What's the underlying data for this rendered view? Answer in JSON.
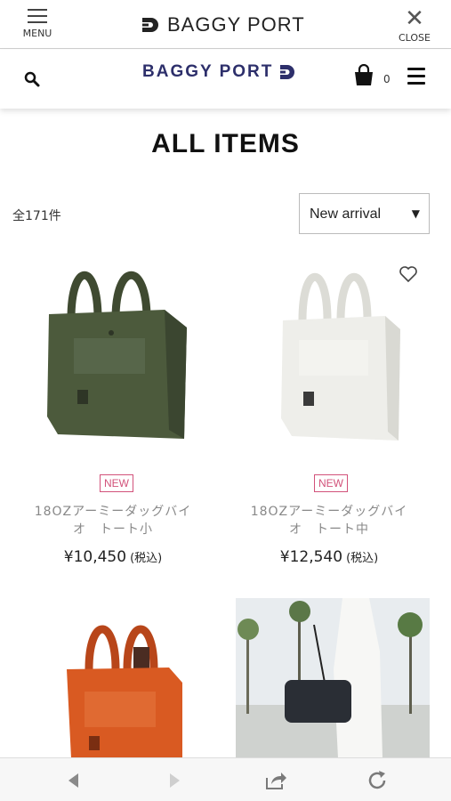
{
  "appbar": {
    "menu_label": "MENU",
    "brand": "BAGGY PORT",
    "close_label": "CLOSE"
  },
  "header": {
    "logo_text": "BAGGY PORT",
    "cart_count": "0",
    "brand_color": "#2d2f6b"
  },
  "page_title": "ALL ITEMS",
  "listing": {
    "count_text": "全171件",
    "sort_selected": "New arrival"
  },
  "products": [
    {
      "badge": "NEW",
      "name_line1": "18OZアーミーダッグバイ",
      "name_line2": "オ　トート小",
      "price": "¥10,450",
      "tax": "(税込)",
      "color": "#4c5a3c"
    },
    {
      "badge": "NEW",
      "name_line1": "18OZアーミーダッグバイ",
      "name_line2": "オ　トート中",
      "price": "¥12,540",
      "tax": "(税込)",
      "color": "#eeeeea"
    },
    {
      "color": "#d95a22"
    },
    {
      "color": "#2a2e35"
    }
  ],
  "colors": {
    "badge": "#d2527a"
  }
}
